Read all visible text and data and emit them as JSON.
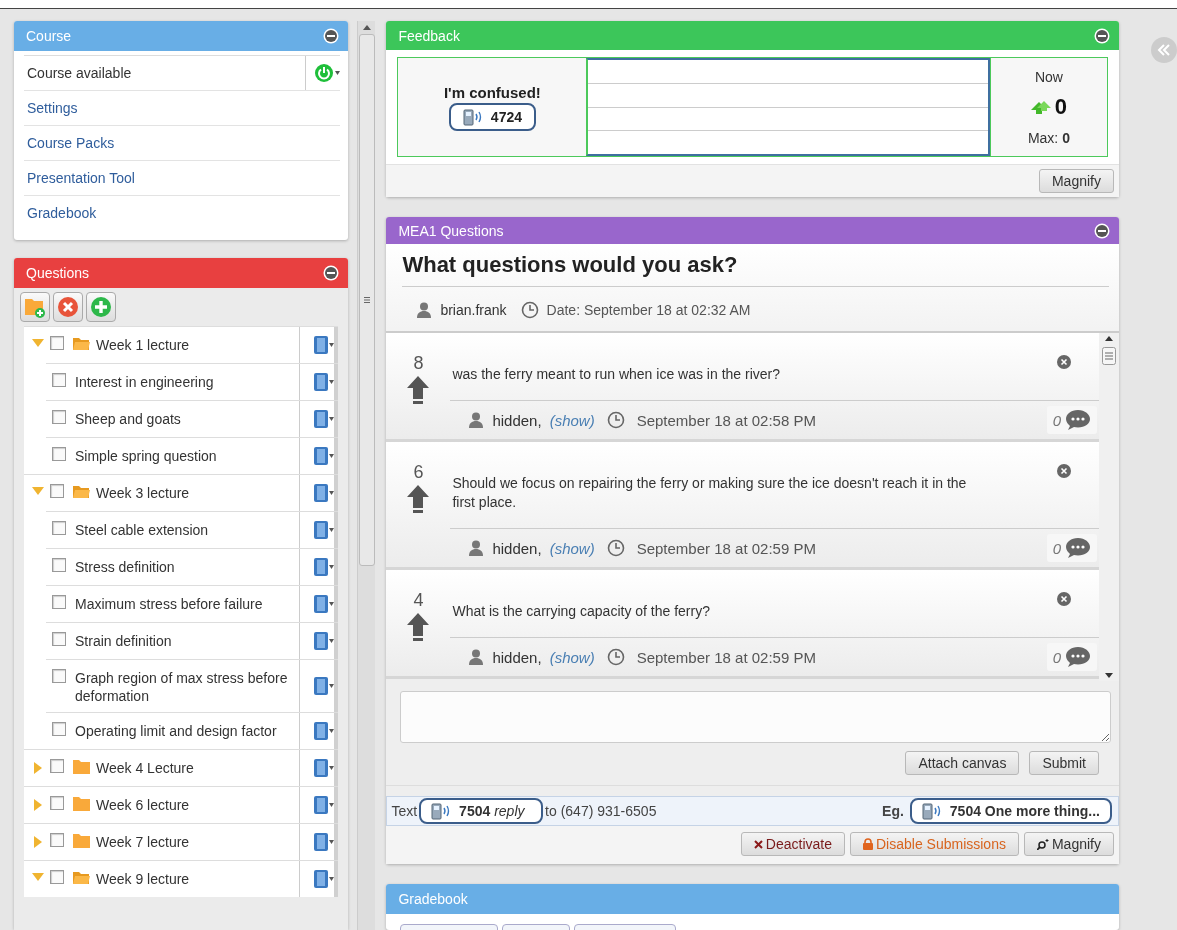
{
  "course_panel": {
    "title": "Course",
    "items": [
      {
        "kind": "toggle",
        "label": "Course available",
        "on": true
      },
      {
        "kind": "link",
        "label": "Settings"
      },
      {
        "kind": "link",
        "label": "Course Packs"
      },
      {
        "kind": "link",
        "label": "Presentation Tool"
      },
      {
        "kind": "link",
        "label": "Gradebook"
      }
    ]
  },
  "questions_panel": {
    "title": "Questions",
    "tree": [
      {
        "kind": "folder",
        "label": "Week 1 lecture",
        "expanded": true,
        "checked": false,
        "children": [
          {
            "kind": "question",
            "label": "Interest in engineering",
            "checked": false
          },
          {
            "kind": "question",
            "label": "Sheep and goats",
            "checked": false
          },
          {
            "kind": "question",
            "label": "Simple spring question",
            "checked": false
          }
        ]
      },
      {
        "kind": "folder",
        "label": "Week 3 lecture",
        "expanded": true,
        "checked": false,
        "children": [
          {
            "kind": "question",
            "label": "Steel cable extension",
            "checked": false
          },
          {
            "kind": "question",
            "label": "Stress definition",
            "checked": false
          },
          {
            "kind": "question",
            "label": "Maximum stress before failure",
            "checked": false
          },
          {
            "kind": "question",
            "label": "Strain definition",
            "checked": false
          },
          {
            "kind": "question",
            "label": "Graph region of max stress before deformation",
            "checked": false
          },
          {
            "kind": "question",
            "label": "Operating limit and design factor",
            "checked": false
          }
        ]
      },
      {
        "kind": "folder",
        "label": "Week 4 Lecture",
        "expanded": false,
        "checked": false
      },
      {
        "kind": "folder",
        "label": "Week 6 lecture",
        "expanded": false,
        "checked": false
      },
      {
        "kind": "folder",
        "label": "Week 7 lecture",
        "expanded": false,
        "checked": false
      },
      {
        "kind": "folder",
        "label": "Week 9 lecture",
        "expanded": true,
        "checked": false
      }
    ]
  },
  "feedback": {
    "title": "Feedback",
    "prompt": "I'm confused!",
    "code": "4724",
    "now_label": "Now",
    "now_value": "0",
    "max_label": "Max:",
    "max_value": "0",
    "button": "Magnify"
  },
  "mea": {
    "title": "MEA1 Questions",
    "question": "What questions would you ask?",
    "author": "brian.frank",
    "date": "Date: September 18 at 02:32 AM",
    "posts": [
      {
        "votes": "8",
        "text": "was the ferry meant to run when ice was in the river?",
        "author": "hidden,",
        "show": "(show)",
        "time": "September 18 at 02:58 PM",
        "comments": "0"
      },
      {
        "votes": "6",
        "text": "Should we focus on repairing the ferry or making sure the ice doesn't reach it in the first place.",
        "author": "hidden,",
        "show": "(show)",
        "time": "September 18 at 02:59 PM",
        "comments": "0"
      },
      {
        "votes": "4",
        "text": "What is the carrying capacity of the ferry?",
        "author": "hidden,",
        "show": "(show)",
        "time": "September 18 at 02:59 PM",
        "comments": "0"
      }
    ],
    "buttons": [
      "Attach canvas",
      "Submit"
    ],
    "sms": {
      "prefix": "Text",
      "code": "7504",
      "keyword": "reply",
      "number": "to (647) 931-6505",
      "example_label": "Eg.",
      "example": "7504 One more thing..."
    },
    "actions": [
      {
        "kind": "deactivate",
        "label": "Deactivate"
      },
      {
        "kind": "disable",
        "label": "Disable Submissions"
      },
      {
        "kind": "magnify",
        "label": "Magnify"
      }
    ]
  },
  "gradebook": {
    "title": "Gradebook"
  }
}
